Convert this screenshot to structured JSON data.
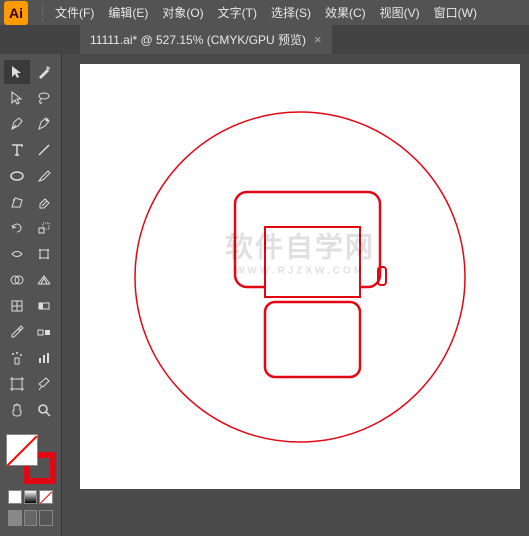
{
  "logo": "Ai",
  "menu": [
    "文件(F)",
    "编辑(E)",
    "对象(O)",
    "文字(T)",
    "选择(S)",
    "效果(C)",
    "视图(V)",
    "窗口(W)"
  ],
  "tab": {
    "label": "11111.ai* @ 527.15% (CMYK/GPU 预览)",
    "close": "×"
  },
  "tools": {
    "row1": [
      "selection",
      "magic-wand"
    ],
    "row2": [
      "direct-selection",
      "lasso"
    ],
    "row3": [
      "pen",
      "curvature"
    ],
    "row4": [
      "type",
      "line"
    ],
    "row5": [
      "ellipse",
      "paintbrush"
    ],
    "row6": [
      "shaper",
      "eraser"
    ],
    "row7": [
      "rotate",
      "scale"
    ],
    "row8": [
      "width",
      "free-transform"
    ],
    "row9": [
      "shape-builder",
      "perspective"
    ],
    "row10": [
      "mesh",
      "gradient"
    ],
    "row11": [
      "eyedropper",
      "blend"
    ],
    "row12": [
      "symbol-sprayer",
      "column-graph"
    ],
    "row13": [
      "artboard",
      "slice"
    ],
    "row14": [
      "hand",
      "zoom"
    ]
  },
  "watermark": {
    "main": "软件自学网",
    "sub": "WWW.RJZXW.COM"
  },
  "colors": {
    "stroke": "#e30613",
    "fill": "none"
  }
}
